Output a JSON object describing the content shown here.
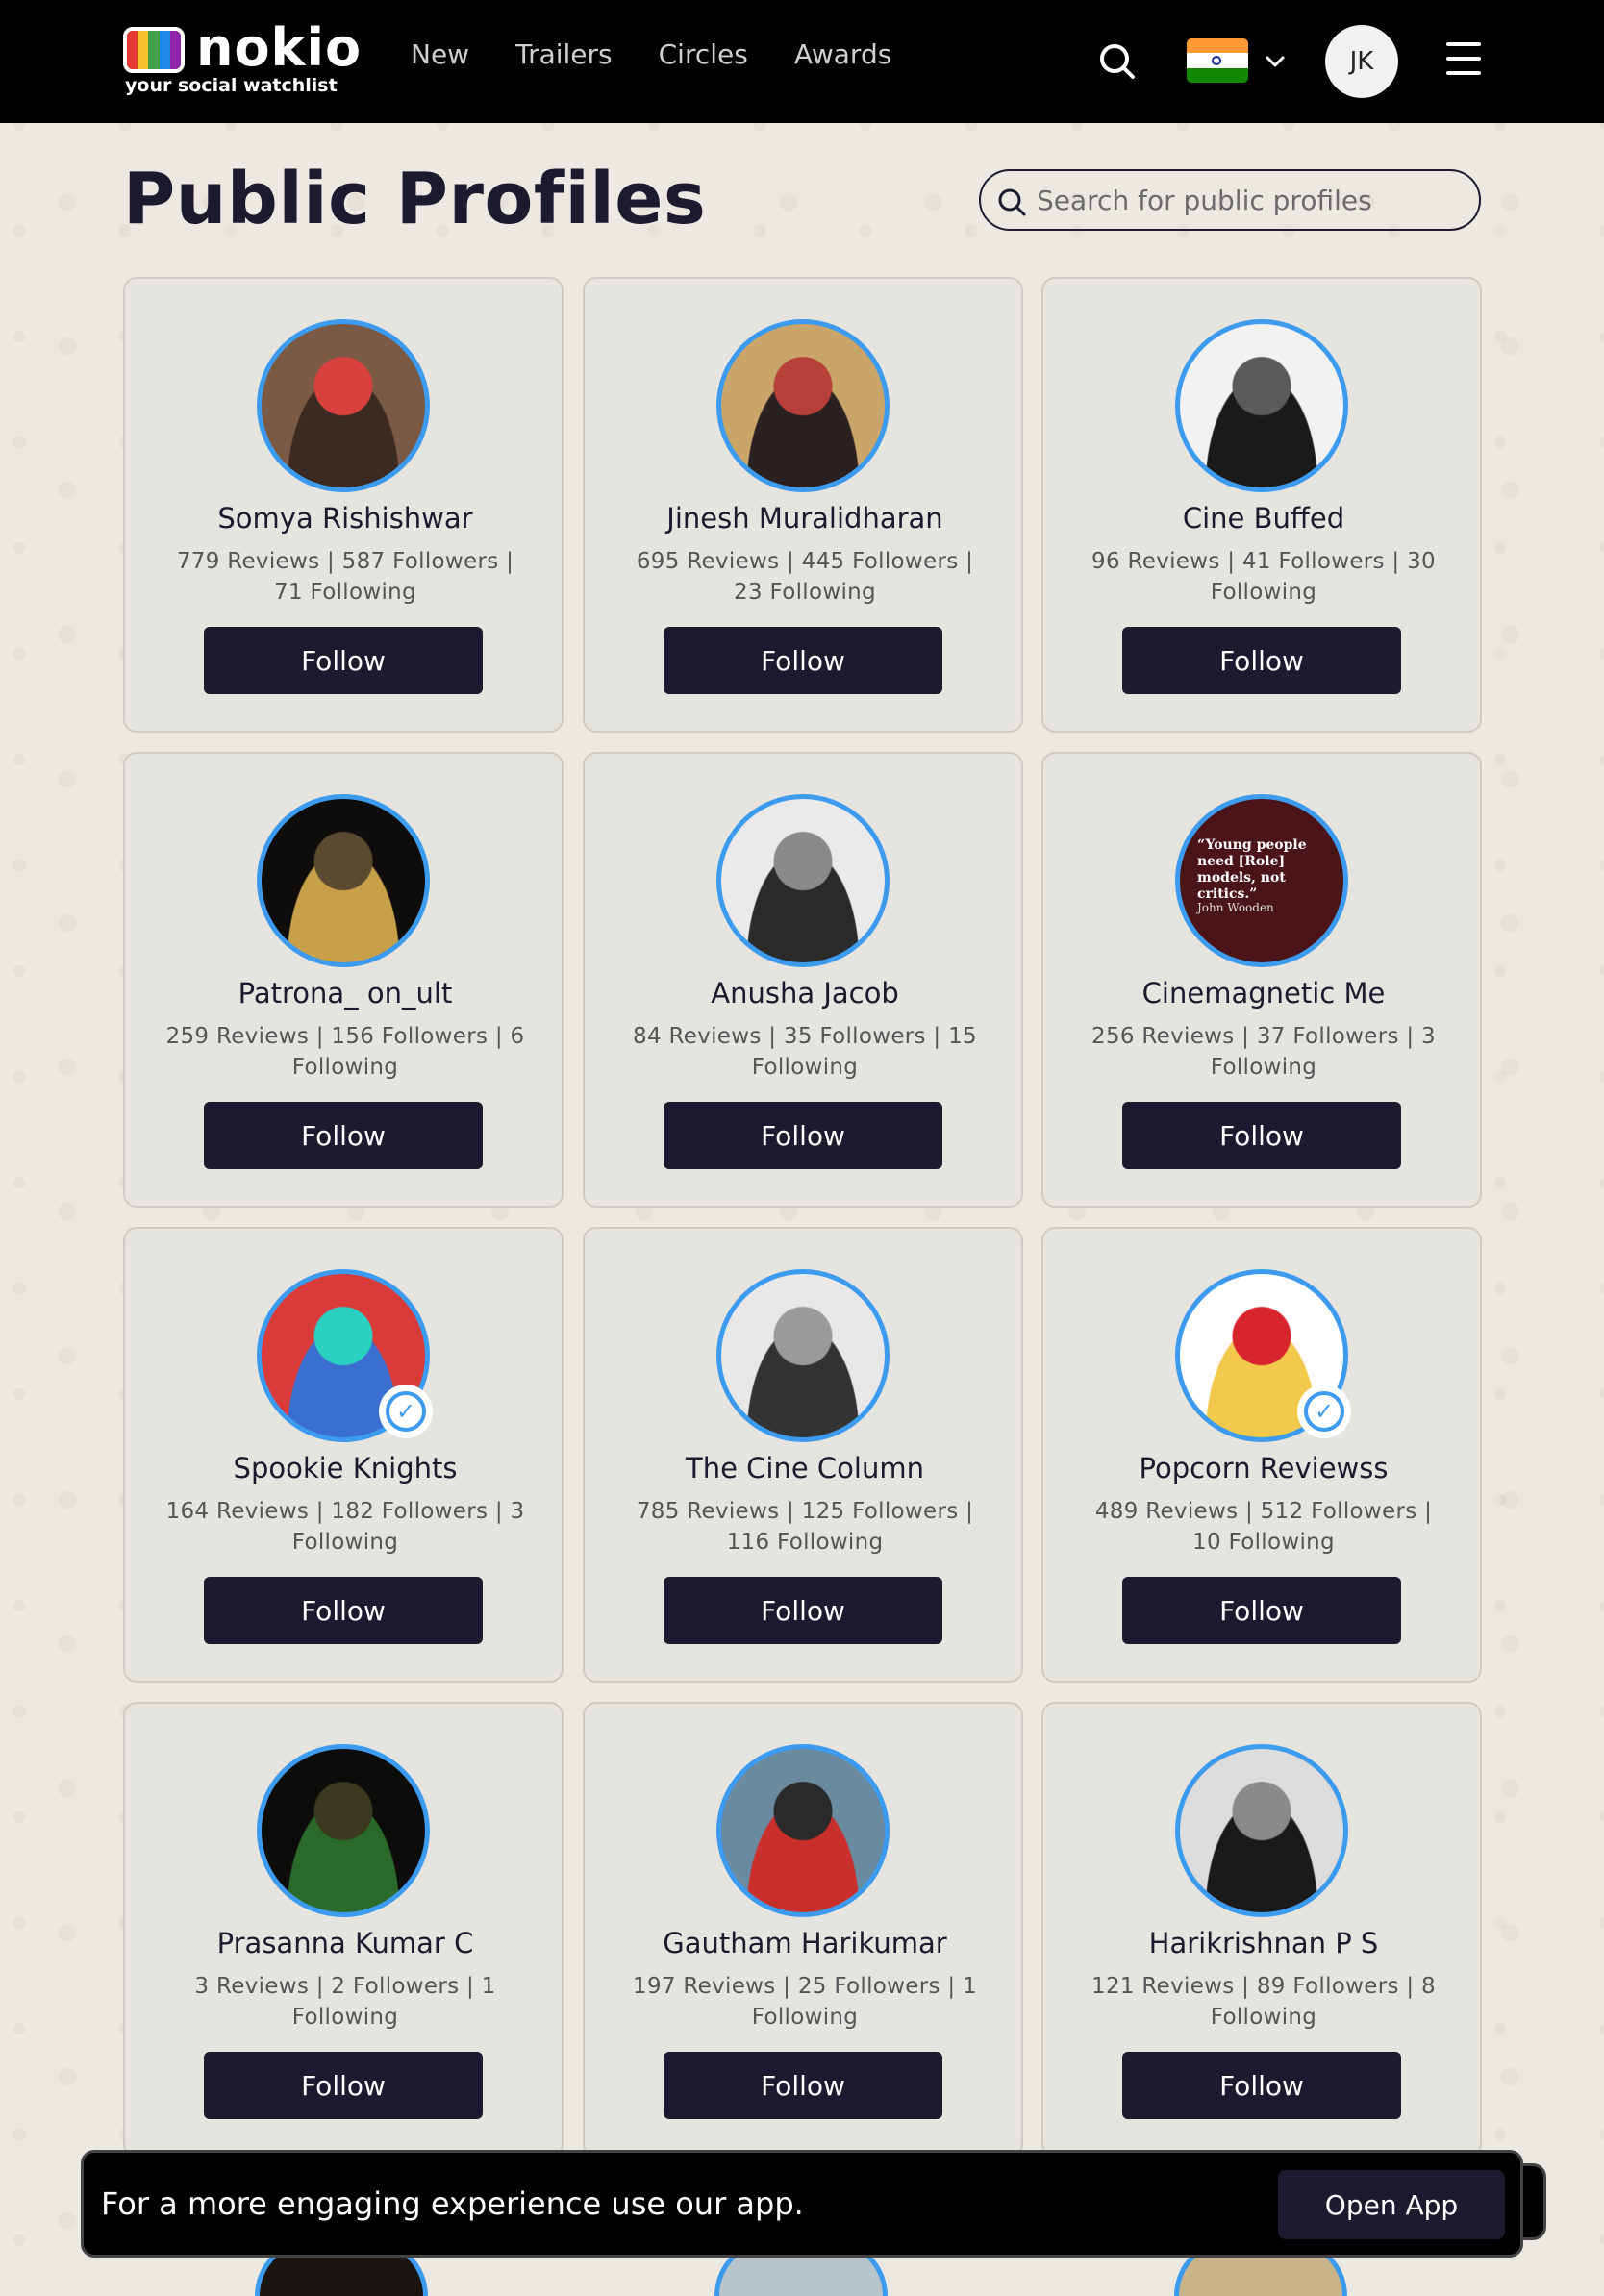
{
  "header": {
    "logo_word": "nokio",
    "logo_tagline": "your social watchlist",
    "nav": [
      "New",
      "Trailers",
      "Circles",
      "Awards"
    ],
    "user_initials": "JK",
    "colors": {
      "background": "#000000",
      "nav_text": "#cfcfcf"
    }
  },
  "page": {
    "title": "Public Profiles",
    "search_placeholder": "Search for public profiles"
  },
  "profiles": [
    {
      "name": "Somya Rishishwar",
      "stats": "779 Reviews | 587 Followers | 71 Following",
      "follow_label": "Follow",
      "verified": false,
      "avatar_colors": [
        "#7a5a45",
        "#d9413e",
        "#3a2a22"
      ]
    },
    {
      "name": "Jinesh Muralidharan",
      "stats": "695 Reviews | 445 Followers | 23 Following",
      "follow_label": "Follow",
      "verified": false,
      "avatar_colors": [
        "#c9a56a",
        "#b8403a",
        "#2a2020"
      ]
    },
    {
      "name": "Cine Buffed",
      "stats": "96 Reviews | 41 Followers | 30 Following",
      "follow_label": "Follow",
      "verified": false,
      "avatar_colors": [
        "#f2f2f2",
        "#5a5a5a",
        "#1a1a1a"
      ]
    },
    {
      "name": "Patrona_ on_ult",
      "stats": "259 Reviews | 156 Followers | 6 Following",
      "follow_label": "Follow",
      "verified": false,
      "avatar_colors": [
        "#0f0d0b",
        "#5a4a30",
        "#c9a04a"
      ]
    },
    {
      "name": "Anusha Jacob",
      "stats": "84 Reviews | 35 Followers | 15 Following",
      "follow_label": "Follow",
      "verified": false,
      "avatar_colors": [
        "#eaeaea",
        "#8a8a8a",
        "#2a2a2a"
      ]
    },
    {
      "name": "Cinemagnetic Me",
      "stats": "256 Reviews | 37 Followers | 3 Following",
      "follow_label": "Follow",
      "verified": false,
      "avatar_colors": [
        "#4a1418",
        "#2a0c10",
        "#6a2024"
      ],
      "avatar_quote": "“Young people need [Role] models, not critics.”",
      "avatar_quote_author": "John Wooden"
    },
    {
      "name": "Spookie Knights",
      "stats": "164 Reviews | 182 Followers | 3 Following",
      "follow_label": "Follow",
      "verified": true,
      "avatar_colors": [
        "#d93a3a",
        "#2ad1c1",
        "#3a6fd1"
      ]
    },
    {
      "name": "The Cine Column",
      "stats": "785 Reviews | 125 Followers | 116 Following",
      "follow_label": "Follow",
      "verified": false,
      "avatar_colors": [
        "#e8e8e8",
        "#9a9a9a",
        "#333333"
      ]
    },
    {
      "name": "Popcorn Reviewss",
      "stats": "489 Reviews | 512 Followers | 10 Following",
      "follow_label": "Follow",
      "verified": true,
      "avatar_colors": [
        "#ffffff",
        "#d8242c",
        "#f2c94c"
      ]
    },
    {
      "name": "Prasanna Kumar C",
      "stats": "3 Reviews | 2 Followers | 1 Following",
      "follow_label": "Follow",
      "verified": false,
      "avatar_colors": [
        "#0c0c0a",
        "#3a3a20",
        "#2a6a2a"
      ]
    },
    {
      "name": "Gautham Harikumar",
      "stats": "197 Reviews | 25 Followers | 1 Following",
      "follow_label": "Follow",
      "verified": false,
      "avatar_colors": [
        "#6a8aa0",
        "#2a2a2a",
        "#c9302c"
      ]
    },
    {
      "name": "Harikrishnan P S",
      "stats": "121 Reviews | 89 Followers | 8 Following",
      "follow_label": "Follow",
      "verified": false,
      "avatar_colors": [
        "#dcdcdc",
        "#8a8a8a",
        "#1a1a1a"
      ]
    }
  ],
  "banner": {
    "text": "For a more engaging experience use our app.",
    "button_label": "Open App"
  },
  "colors": {
    "accent": "#3d9bef",
    "button": "#1b1a2e",
    "card_bg": "#e6e4df",
    "page_bg": "#ece9e2"
  }
}
